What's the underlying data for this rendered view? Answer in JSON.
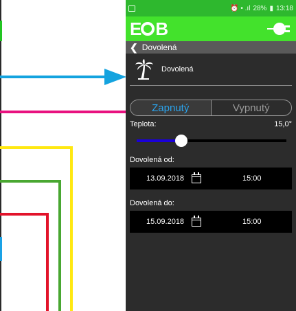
{
  "status_bar": {
    "indicators": "⏰ • .ıl",
    "battery": "28%",
    "time": "13:18"
  },
  "app": {
    "logo_left": "E",
    "logo_right": "B"
  },
  "header": {
    "title": "Dovolená"
  },
  "vacation": {
    "label": "Dovolená",
    "icon": "palm-tree-icon"
  },
  "toggle": {
    "on_label": "Zapnutý",
    "off_label": "Vypnutý",
    "selected": "Zapnutý"
  },
  "temperature": {
    "label": "Teplota:",
    "value": "15,0°",
    "slider_fraction": 0.3
  },
  "from": {
    "label": "Dovolená od:",
    "date": "13.09.2018",
    "time": "15:00"
  },
  "to": {
    "label": "Dovolená do:",
    "date": "15.09.2018",
    "time": "15:00"
  },
  "colors": {
    "status_green": "#2eb82e",
    "appbar_green": "#43e22c",
    "accent_blue": "#2aa4ee",
    "slider_fill": "#1a00d8",
    "callout_blue": "#14a3df",
    "callout_magenta": "#e8117f",
    "callout_yellow": "#ffe812",
    "callout_green": "#49a731",
    "callout_red": "#e2132a"
  }
}
